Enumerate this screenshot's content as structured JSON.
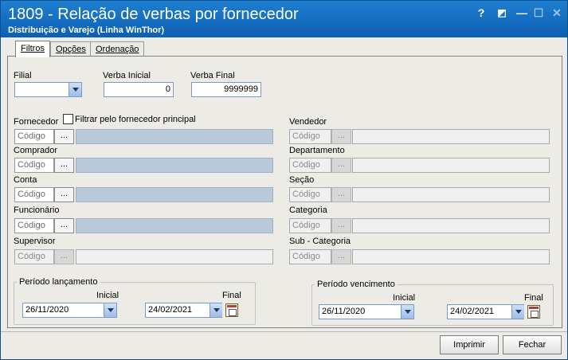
{
  "window": {
    "title": "1809 - Relação de verbas por fornecedor",
    "subtitle": "Distribuição e Varejo (Linha WinThor)",
    "controls": {
      "help": "?",
      "minimize": "—",
      "maximize": "☐",
      "close": "✕"
    }
  },
  "tabs": [
    {
      "label": "Filtros",
      "active": true
    },
    {
      "label": "Opções",
      "active": false
    },
    {
      "label": "Ordenação",
      "active": false
    }
  ],
  "filtros": {
    "filial_label": "Filial",
    "filial_value": "",
    "verba_inicial_label": "Verba Inicial",
    "verba_inicial_value": "0",
    "verba_final_label": "Verba Final",
    "verba_final_value": "9999999",
    "lookup_placeholder": "Código",
    "lookup_button": "...",
    "checkbox_label": "Filtrar pelo fornecedor principal",
    "left_lookups": [
      {
        "label": "Fornecedor",
        "enabled": true
      },
      {
        "label": "Comprador",
        "enabled": true
      },
      {
        "label": "Conta",
        "enabled": true
      },
      {
        "label": "Funcionário",
        "enabled": true
      },
      {
        "label": "Supervisor",
        "enabled": false
      }
    ],
    "right_lookups": [
      {
        "label": "Vendedor",
        "enabled": false
      },
      {
        "label": "Departamento",
        "enabled": false
      },
      {
        "label": "Seção",
        "enabled": false
      },
      {
        "label": "Categoria",
        "enabled": false
      },
      {
        "label": "Sub - Categoria",
        "enabled": false
      }
    ]
  },
  "periodo_lancamento": {
    "title": "Período lançamento",
    "inicial_label": "Inicial",
    "inicial_value": "26/11/2020",
    "final_label": "Final",
    "final_value": "24/02/2021"
  },
  "periodo_vencimento": {
    "title": "Período vencimento",
    "inicial_label": "Inicial",
    "inicial_value": "26/11/2020",
    "final_label": "Final",
    "final_value": "24/02/2021"
  },
  "buttons": {
    "imprimir": "Imprimir",
    "fechar": "Fechar"
  },
  "colors": {
    "titlebar": "#1373c7",
    "panel": "#ecebe6",
    "lookup_fill": "#b9c9d9"
  }
}
